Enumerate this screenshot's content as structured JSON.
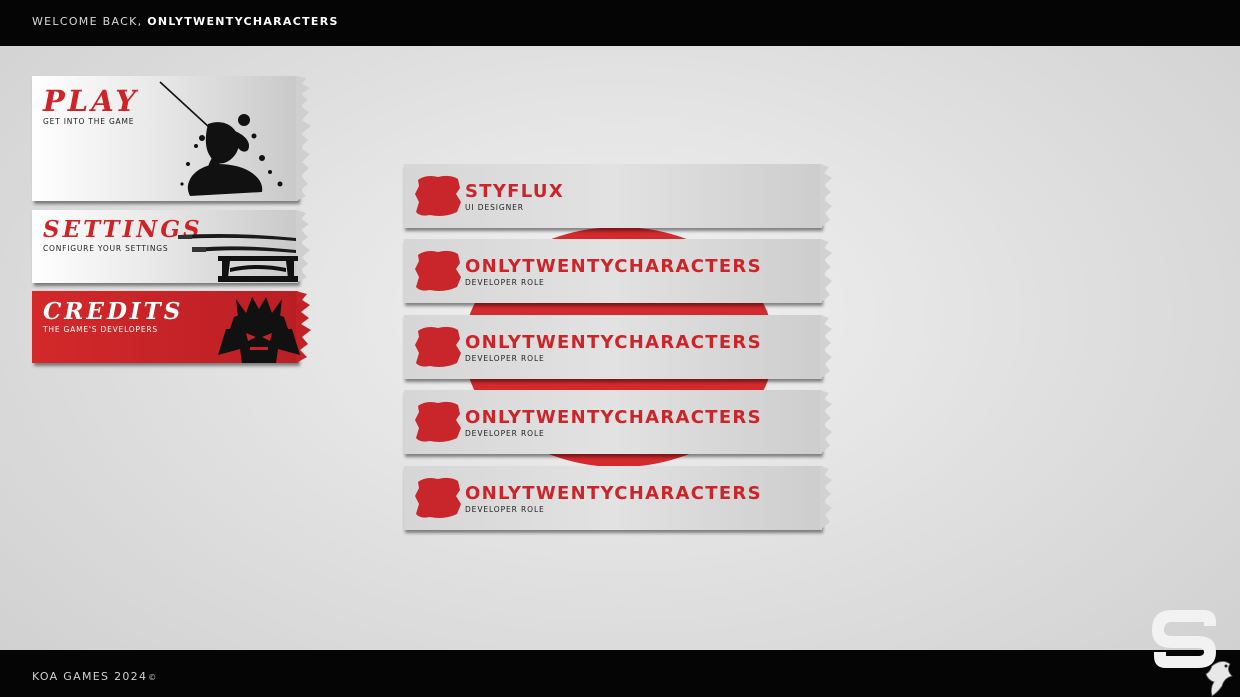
{
  "header": {
    "welcome_prefix": "WELCOME BACK,",
    "username": "ONLYTWENTYCHARACTERS"
  },
  "menu": [
    {
      "title": "PLAY",
      "subtitle": "GET INTO THE GAME",
      "icon": "samurai-warrior-icon"
    },
    {
      "title": "SETTINGS",
      "subtitle": "CONFIGURE YOUR SETTINGS",
      "icon": "katana-stand-icon"
    },
    {
      "title": "CREDITS",
      "subtitle": "THE GAME'S DEVELOPERS",
      "icon": "samurai-helmet-icon",
      "active": true
    }
  ],
  "credits": [
    {
      "name": "STYFLUX",
      "role": "UI DESIGNER"
    },
    {
      "name": "ONLYTWENTYCHARACTERS",
      "role": "DEVELOPER ROLE"
    },
    {
      "name": "ONLYTWENTYCHARACTERS",
      "role": "DEVELOPER ROLE"
    },
    {
      "name": "ONLYTWENTYCHARACTERS",
      "role": "DEVELOPER ROLE"
    },
    {
      "name": "ONLYTWENTYCHARACTERS",
      "role": "DEVELOPER ROLE"
    }
  ],
  "footer": {
    "text": "KOA GAMES 2024",
    "copyright": "©"
  },
  "colors": {
    "accent": "#cc2428",
    "bar": "#050505"
  },
  "logo_icon": "studio-s-eagle-logo-icon"
}
